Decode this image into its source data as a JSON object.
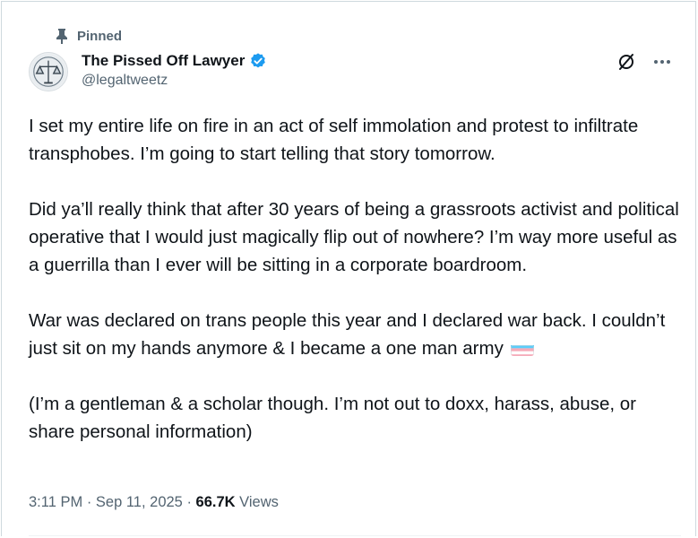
{
  "pinned": {
    "label": "Pinned"
  },
  "author": {
    "name": "The Pissed Off Lawyer",
    "handle": "@legaltweetz",
    "verified": true
  },
  "tweet": {
    "paragraphs": [
      "I set my entire life on fire in an act of self immolation and protest to infiltrate transphobes. I’m going to start telling that story tomorrow.",
      "Did ya’ll really think that after 30 years of being a grassroots activist and political operative that I would just magically flip out of nowhere? I’m way more useful as a guerrilla than I ever will be sitting in a corporate boardroom.",
      "War was declared on trans people this year and I declared war back. I couldn’t just sit on my hands anymore & I became a one man army",
      "(I’m a gentleman & a scholar though. I’m not out to doxx, harass, abuse, or share personal information)"
    ],
    "emoji": "transgender-flag-icon"
  },
  "meta": {
    "time": "3:11 PM",
    "separator1": " · ",
    "date": "Sep 11, 2025",
    "separator2": " · ",
    "views_count": "66.7K",
    "views_label": " Views"
  },
  "colors": {
    "text": "#0f1419",
    "secondary": "#536471",
    "verified": "#1d9bf0",
    "flag_blue": "#5bcefa",
    "flag_pink": "#f5a9b8",
    "flag_white": "#ffffff"
  }
}
